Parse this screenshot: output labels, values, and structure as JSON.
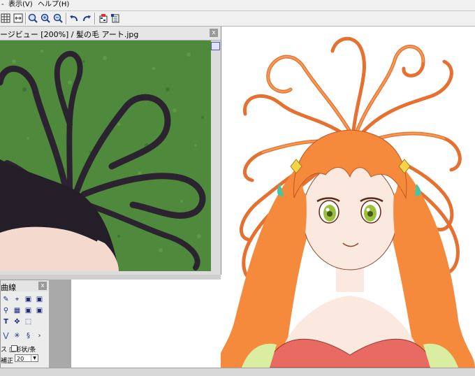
{
  "menubar": {
    "items": [
      {
        "label": "表示(V)"
      },
      {
        "label": "ヘルプ(H)"
      }
    ]
  },
  "toolbar": {
    "icons": [
      "grid-icon",
      "fit-window-icon",
      "zoom-icon",
      "zoom-in-icon",
      "zoom-out-icon",
      "undo-icon",
      "redo-icon",
      "palette-icon",
      "settings-icon"
    ]
  },
  "viewer": {
    "title": "ージビュー [200%] / 髪の毛 アート.jpg",
    "close_label": "x"
  },
  "palette": {
    "title": "曲線",
    "close_label": "x",
    "checkbox_label": "ス  □形状/条",
    "correction_label": "補正",
    "correction_value": "20"
  },
  "colors": {
    "hair": "#f58a3c",
    "hair_dark": "#d9622a",
    "grass": "#4f8a3c",
    "dress": "#e86a63",
    "skin": "#fbe8df",
    "eye": "#9bbf3a"
  }
}
